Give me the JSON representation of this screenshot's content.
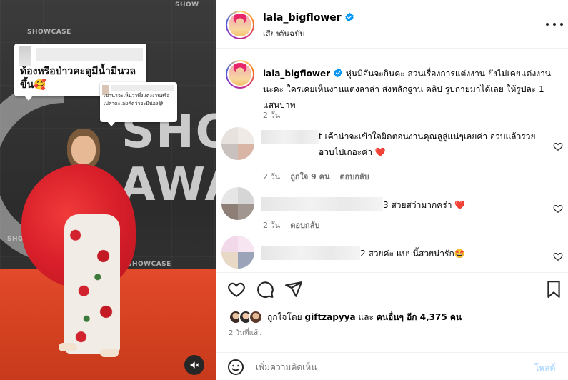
{
  "media": {
    "bubble1_text": "ท้องหรือป่าวคะดูมีน้ำมีนวลขึ้น🥰",
    "bubble2_text": "เขาน่าจะเห็นว่าพึ่งแต่งงานหรือเปล่าคะเลยคิดว่าจะมีน้อง😅",
    "wall_words": [
      "SHO",
      "AWA"
    ],
    "mute_icon": "speaker-muted-icon"
  },
  "header": {
    "username": "lala_bigflower",
    "audio_label": "เสียงต้นฉบับ"
  },
  "caption": {
    "username": "lala_bigflower",
    "text": "หุ่นมีอันจะกินคะ ส่วนเรื่องการแต่งงาน ยังไม่เคยแต่งงานนะคะ ใครเคยเห็นงานแต่งลาล่า ส่งหลักฐาน คลิป รูปถ่ายมาได้เลย ให้รูปละ 1 แสนบาท",
    "time": "2 วัน"
  },
  "comments": [
    {
      "text": "t เค้าน่าจะเข้าใจผิดตอนงานคุณลูลู่แน่ๆเลยค่า อวบแล้วรวย อวบไปเถอะค่า ❤️",
      "time": "2 วัน",
      "likes": "ถูกใจ 9 คน",
      "reply": "ตอบกลับ",
      "avatar_colors": [
        "#e8e2de",
        "#f0eae6",
        "#c9c1bd",
        "#d8b5a5"
      ]
    },
    {
      "text": "3 สวยสว่ามากคร่า ❤️",
      "time": "2 วัน",
      "reply": "ตอบกลับ",
      "avatar_colors": [
        "#e6e6e6",
        "#d6d6d6",
        "#8d7f76",
        "#a29790"
      ]
    },
    {
      "text": "2 สวยค่ะ แบบนี้สวยน่ารัก🤩",
      "avatar_colors": [
        "#f2d9ea",
        "#f7e6f1",
        "#e8d8c6",
        "#9aa3b8"
      ]
    }
  ],
  "actions": {
    "like_icon": "heart-icon",
    "comment_icon": "comment-icon",
    "share_icon": "share-icon",
    "save_icon": "bookmark-icon"
  },
  "likes": {
    "prefix": "ถูกใจโดย",
    "user": "giftzapyya",
    "middle": "และ",
    "others": "คนอื่นๆ อีก 4,375 คน"
  },
  "posted": "2 วันที่แล้ว",
  "composer": {
    "placeholder": "เพิ่มความคิดเห็น",
    "post_label": "โพสต์"
  },
  "colors": {
    "verified": "#0095f6",
    "heart_red": "#ff3040",
    "muted_text": "#737373"
  }
}
